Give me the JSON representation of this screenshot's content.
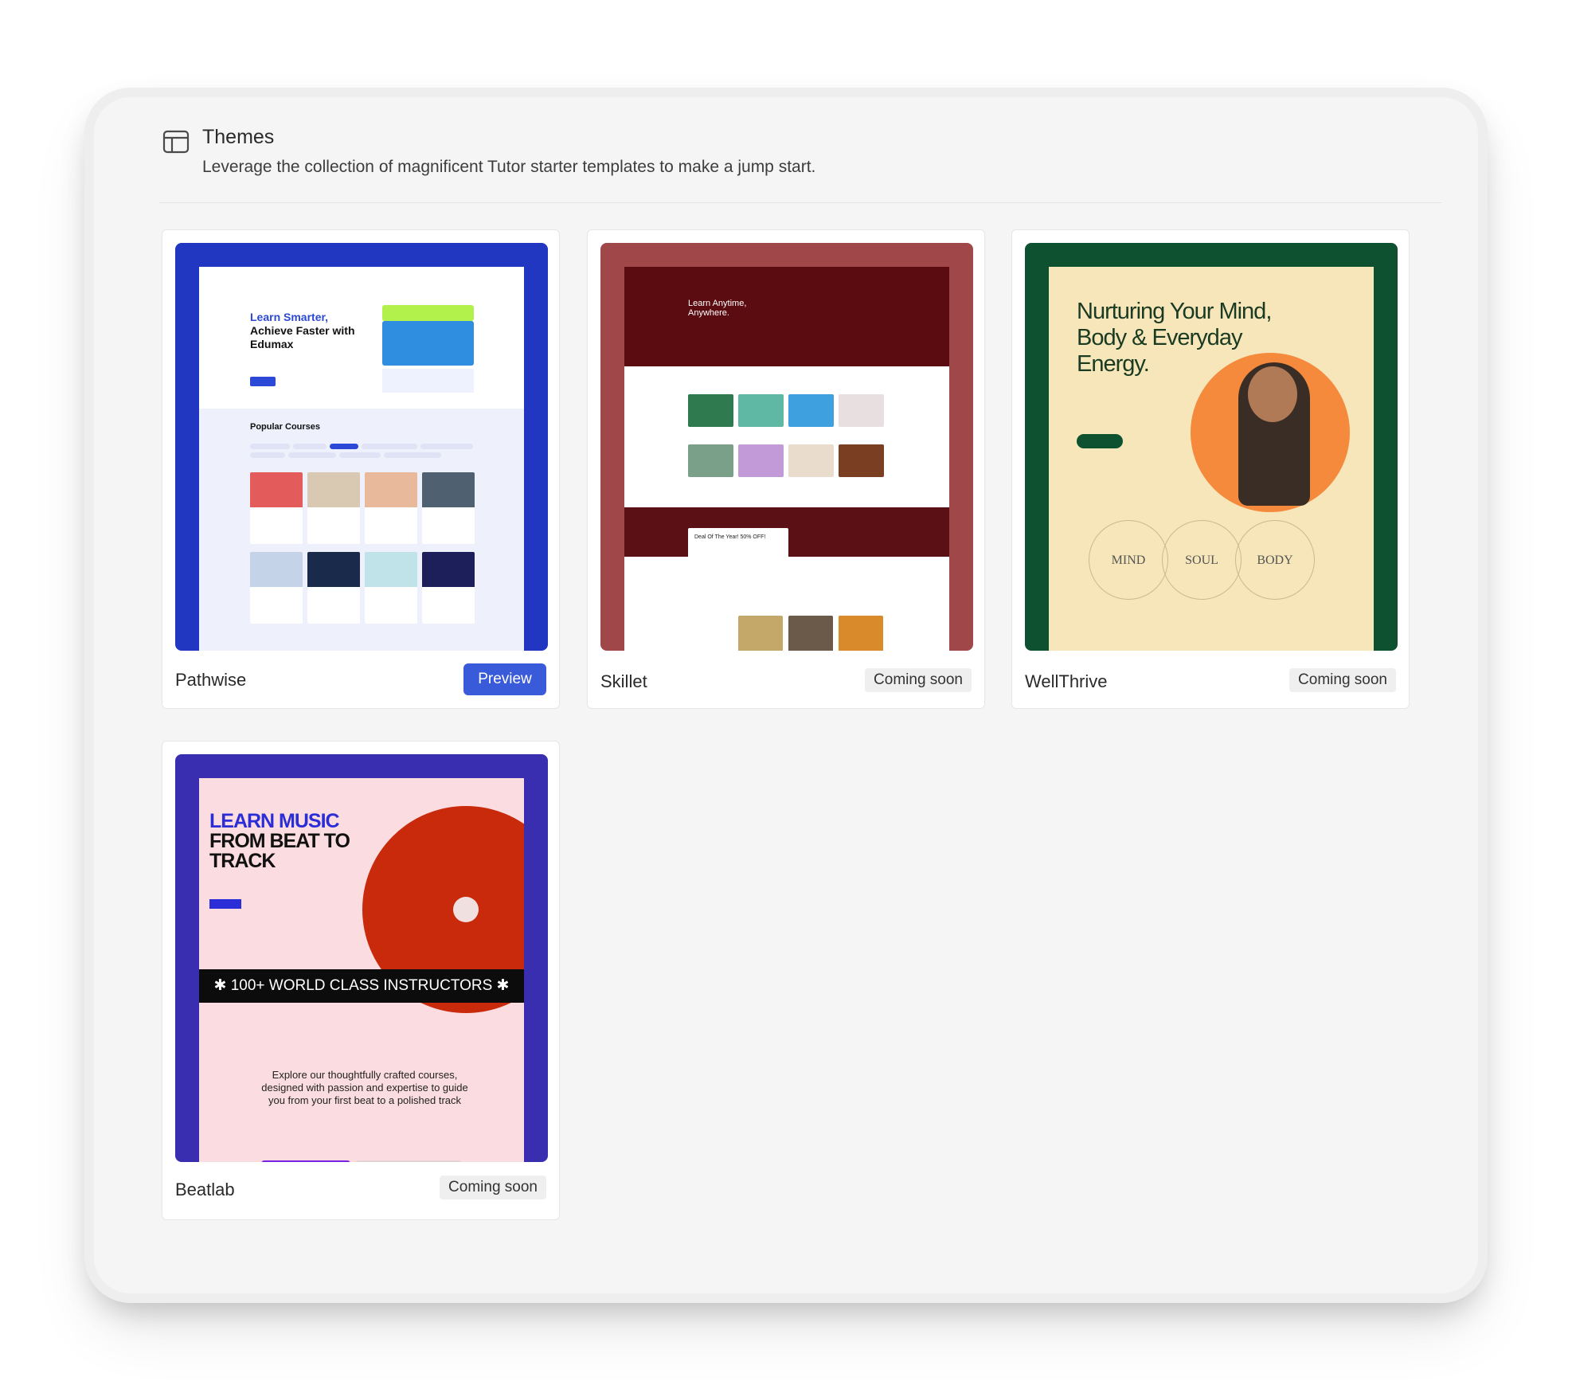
{
  "header": {
    "icon": "layout-template-icon",
    "title": "Themes",
    "subtitle": "Leverage the collection of magnificent Tutor starter templates to make a jump start."
  },
  "themes": [
    {
      "name": "Pathwise",
      "action": "Preview",
      "preview": {
        "headline_accent": "Learn Smarter,",
        "headline": "Achieve Faster with Edumax",
        "section": "Popular Courses"
      }
    },
    {
      "name": "Skillet",
      "status": "Coming soon",
      "preview": {
        "headline": "Learn Anytime, Anywhere.",
        "deal": "Deal Of The Year! 50% OFF!"
      }
    },
    {
      "name": "WellThrive",
      "status": "Coming soon",
      "preview": {
        "headline_line1": "Nurturing Your Mind,",
        "headline_line2": "Body & Everyday",
        "headline_line3": "Energy.",
        "circles": [
          "MIND",
          "SOUL",
          "BODY"
        ]
      }
    },
    {
      "name": "Beatlab",
      "status": "Coming soon",
      "preview": {
        "headline_accent": "LEARN MUSIC",
        "headline_line2": "FROM BEAT TO",
        "headline_line3": "TRACK",
        "banner": "100+ WORLD CLASS INSTRUCTORS",
        "paragraph": "Explore our thoughtfully crafted courses, designed with passion and expertise to guide you from your first beat to a polished track"
      }
    }
  ],
  "colors": {
    "primary_button": "#3a5bd9",
    "pathwise_frame": "#2137c2",
    "skillet_frame": "#a0474a",
    "wellthrive_frame": "#0e5130",
    "beatlab_frame": "#3a2eb0"
  }
}
